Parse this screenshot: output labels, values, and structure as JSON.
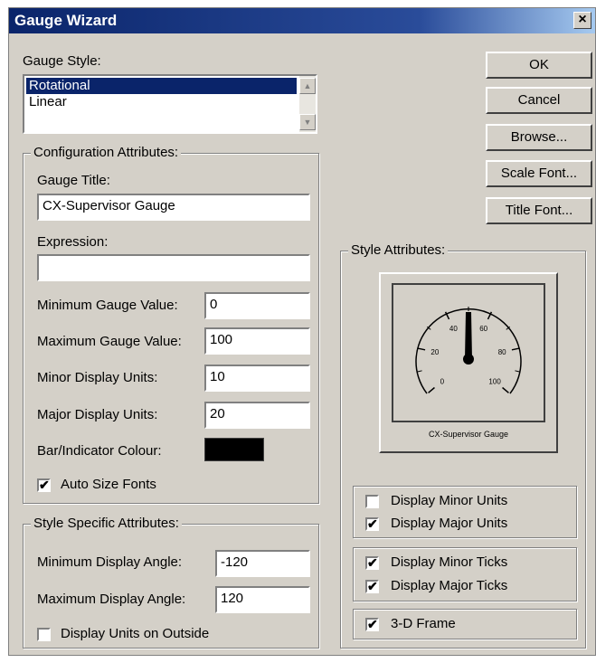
{
  "window": {
    "title": "Gauge Wizard",
    "close_glyph": "×"
  },
  "gauge_style": {
    "label": "Gauge Style:",
    "options": [
      "Rotational",
      "Linear"
    ],
    "selected": "Rotational"
  },
  "buttons": {
    "ok": "OK",
    "cancel": "Cancel",
    "browse": "Browse...",
    "scale_font": "Scale Font...",
    "title_font": "Title Font..."
  },
  "config": {
    "legend": "Configuration Attributes:",
    "gauge_title_label": "Gauge Title:",
    "gauge_title_value": "CX-Supervisor Gauge",
    "expression_label": "Expression:",
    "expression_value": "",
    "min_value_label": "Minimum Gauge Value:",
    "min_value": "0",
    "max_value_label": "Maximum Gauge Value:",
    "max_value": "100",
    "minor_units_label": "Minor Display Units:",
    "minor_units": "10",
    "major_units_label": "Major Display Units:",
    "major_units": "20",
    "colour_label": "Bar/Indicator Colour:",
    "colour_value": "#000000",
    "auto_size_label": "Auto Size Fonts",
    "auto_size_checked": true
  },
  "style_specific": {
    "legend": "Style Specific Attributes:",
    "min_angle_label": "Minimum Display Angle:",
    "min_angle": "-120",
    "max_angle_label": "Maximum Display Angle:",
    "max_angle": "120",
    "units_outside_label": "Display Units on Outside",
    "units_outside_checked": false
  },
  "style_attrs": {
    "legend": "Style Attributes:",
    "preview": {
      "tick_labels": [
        "0",
        "20",
        "40",
        "60",
        "80",
        "100"
      ],
      "caption": "CX-Supervisor Gauge"
    },
    "display_minor_units": {
      "label": "Display Minor Units",
      "checked": false
    },
    "display_major_units": {
      "label": "Display Major Units",
      "checked": true
    },
    "display_minor_ticks": {
      "label": "Display Minor Ticks",
      "checked": true
    },
    "display_major_ticks": {
      "label": "Display Major Ticks",
      "checked": true
    },
    "frame_3d": {
      "label": "3-D Frame",
      "checked": true
    }
  },
  "colors": {
    "face": "#d4d0c8",
    "selection": "#0a246a",
    "title_bar": "#0a246a"
  },
  "icons": {
    "check": "✔",
    "scroll_up": "▲",
    "scroll_down": "▼"
  }
}
